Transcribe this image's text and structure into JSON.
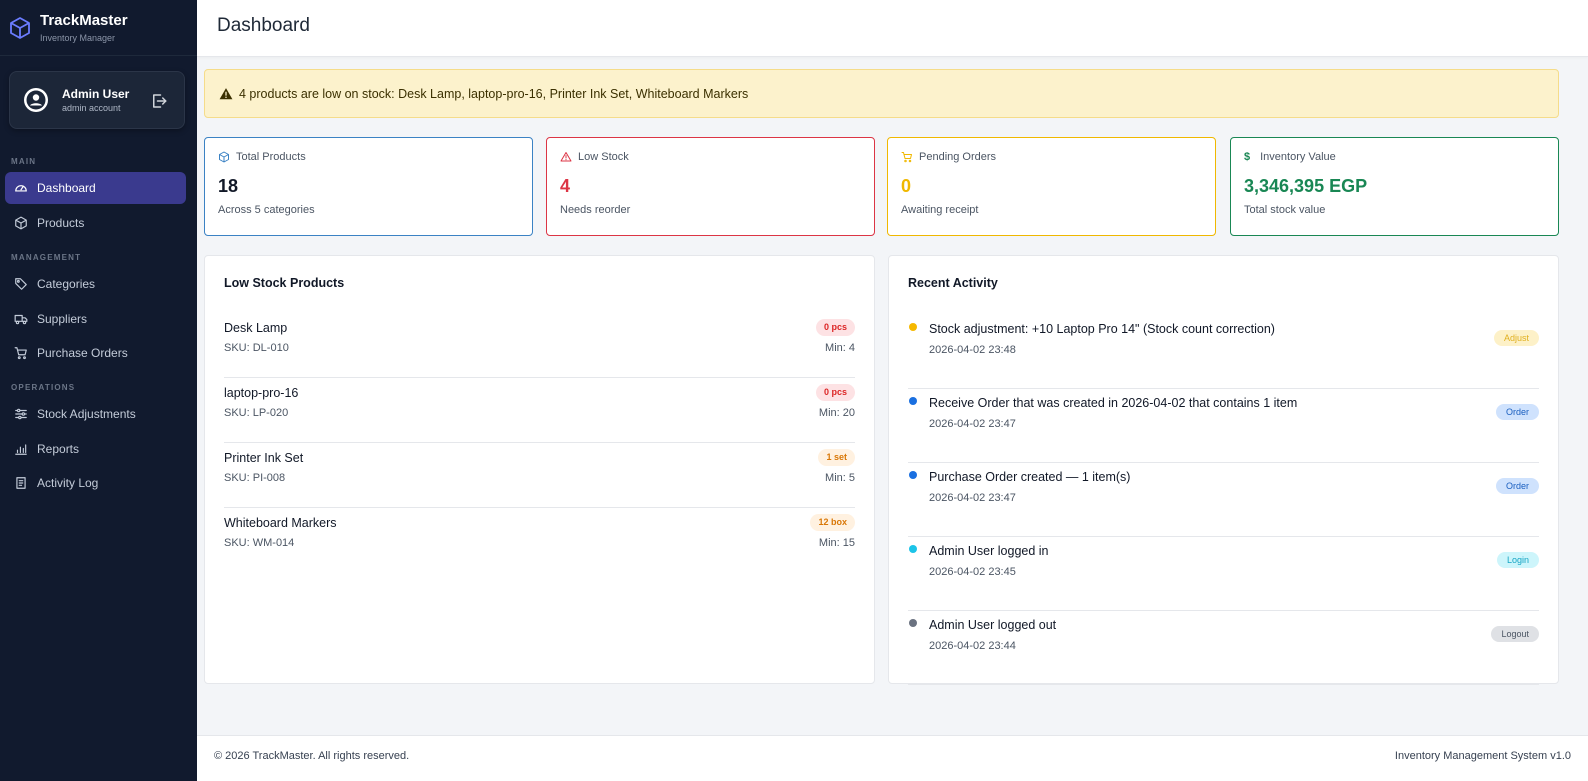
{
  "brand": {
    "title": "TrackMaster",
    "subtitle": "Inventory Manager"
  },
  "user": {
    "name": "Admin User",
    "role": "admin account"
  },
  "sections": {
    "main": "MAIN",
    "management": "MANAGEMENT",
    "operations": "OPERATIONS"
  },
  "nav": {
    "dashboard": "Dashboard",
    "products": "Products",
    "categories": "Categories",
    "suppliers": "Suppliers",
    "purchase_orders": "Purchase Orders",
    "stock_adjustments": "Stock Adjustments",
    "reports": "Reports",
    "activity_log": "Activity Log"
  },
  "header": {
    "title": "Dashboard"
  },
  "alert": {
    "text": "4 products are low on stock: Desk Lamp, laptop-pro-16, Printer Ink Set, Whiteboard Markers"
  },
  "stats": [
    {
      "label": "Total Products",
      "value": "18",
      "sub": "Across 5 categories",
      "color": "#3b82c4"
    },
    {
      "label": "Low Stock",
      "value": "4",
      "sub": "Needs reorder",
      "color": "#dc3545"
    },
    {
      "label": "Pending Orders",
      "value": "0",
      "sub": "Awaiting receipt",
      "color": "#f0b800"
    },
    {
      "label": "Inventory Value",
      "value": "3,346,395 EGP",
      "sub": "Total stock value",
      "color": "#198754"
    }
  ],
  "low_stock": {
    "title": "Low Stock Products",
    "items": [
      {
        "name": "Desk Lamp",
        "sku": "SKU: DL-010",
        "qty": "0 pcs",
        "min": "Min: 4"
      },
      {
        "name": "laptop-pro-16",
        "sku": "SKU: LP-020",
        "qty": "0 pcs",
        "min": "Min: 20"
      },
      {
        "name": "Printer Ink Set",
        "sku": "SKU: PI-008",
        "qty": "1 set",
        "min": "Min: 5"
      },
      {
        "name": "Whiteboard Markers",
        "sku": "SKU: WM-014",
        "qty": "12 box",
        "min": "Min: 15"
      }
    ]
  },
  "activity": {
    "title": "Recent Activity",
    "items": [
      {
        "text": "Stock adjustment: +10 Laptop Pro 14\" (Stock count correction)",
        "time": "2026-04-02 23:48",
        "tag": "Adjust"
      },
      {
        "text": "Receive Order that was created in 2026-04-02 that contains 1 item",
        "time": "2026-04-02 23:47",
        "tag": "Order"
      },
      {
        "text": "Purchase Order created — 1 item(s)",
        "time": "2026-04-02 23:47",
        "tag": "Order"
      },
      {
        "text": "Admin User logged in",
        "time": "2026-04-02 23:45",
        "tag": "Login"
      },
      {
        "text": "Admin User logged out",
        "time": "2026-04-02 23:44",
        "tag": "Logout"
      }
    ]
  },
  "footer": {
    "copyright": "© 2026 TrackMaster. All rights reserved.",
    "version": "Inventory Management System v1.0"
  }
}
